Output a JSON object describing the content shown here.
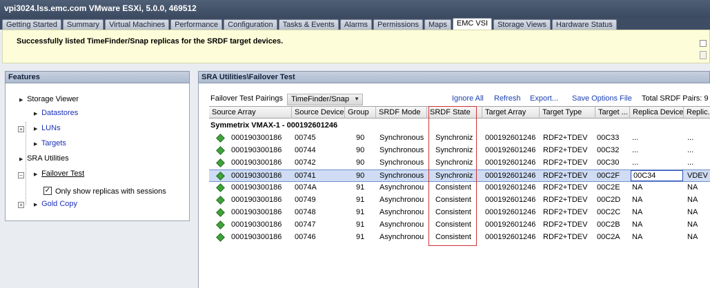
{
  "window": {
    "title": "vpi3024.lss.emc.com VMware ESXi, 5.0.0, 469512"
  },
  "tabs": [
    {
      "label": "Getting Started",
      "active": false
    },
    {
      "label": "Summary",
      "active": false
    },
    {
      "label": "Virtual Machines",
      "active": false
    },
    {
      "label": "Performance",
      "active": false
    },
    {
      "label": "Configuration",
      "active": false
    },
    {
      "label": "Tasks & Events",
      "active": false
    },
    {
      "label": "Alarms",
      "active": false
    },
    {
      "label": "Permissions",
      "active": false
    },
    {
      "label": "Maps",
      "active": false
    },
    {
      "label": "EMC VSI",
      "active": true
    },
    {
      "label": "Storage Views",
      "active": false
    },
    {
      "label": "Hardware Status",
      "active": false
    }
  ],
  "notice": {
    "message": "Successfully listed TimeFinder/Snap replicas for the SRDF target devices."
  },
  "features": {
    "header": "Features",
    "items": {
      "storage_viewer": "Storage Viewer",
      "datastores": "Datastores",
      "luns": "LUNs",
      "targets": "Targets",
      "sra_utilities": "SRA Utilities",
      "failover_test": "Failover Test",
      "only_show_replicas": "Only show replicas with sessions",
      "gold_copy": "Gold Copy"
    },
    "only_show_replicas_checked": true
  },
  "main": {
    "header": "SRA Utilities\\Failover Test",
    "pairings_label": "Failover Test Pairings",
    "pairings_value": "TimeFinder/Snap",
    "links": {
      "ignore_all": "Ignore All",
      "refresh": "Refresh",
      "export": "Export...",
      "save_options": "Save Options File"
    },
    "total_pairs": "Total SRDF Pairs: 9"
  },
  "table": {
    "columns": [
      "Source Array",
      "Source Device",
      "Group",
      "SRDF Mode",
      "SRDF State",
      "Target Array",
      "Target Type",
      "Target ...",
      "Replica Device",
      "Replic..."
    ],
    "group_label": "Symmetrix VMAX-1 - 000192601246",
    "status_color": "#3fa33a",
    "rows": [
      [
        "000190300186",
        "00745",
        "90",
        "Synchronous",
        "Synchroniz",
        "000192601246",
        "RDF2+TDEV",
        "00C33",
        "...",
        "..."
      ],
      [
        "000190300186",
        "00744",
        "90",
        "Synchronous",
        "Synchroniz",
        "000192601246",
        "RDF2+TDEV",
        "00C32",
        "...",
        "..."
      ],
      [
        "000190300186",
        "00742",
        "90",
        "Synchronous",
        "Synchroniz",
        "000192601246",
        "RDF2+TDEV",
        "00C30",
        "...",
        "..."
      ],
      [
        "000190300186",
        "00741",
        "90",
        "Synchronous",
        "Synchroniz",
        "000192601246",
        "RDF2+TDEV",
        "00C2F",
        "00C34",
        "VDEV"
      ],
      [
        "000190300186",
        "0074A",
        "91",
        "Asynchronou",
        "Consistent",
        "000192601246",
        "RDF2+TDEV",
        "00C2E",
        "NA",
        "NA"
      ],
      [
        "000190300186",
        "00749",
        "91",
        "Asynchronou",
        "Consistent",
        "000192601246",
        "RDF2+TDEV",
        "00C2D",
        "NA",
        "NA"
      ],
      [
        "000190300186",
        "00748",
        "91",
        "Asynchronou",
        "Consistent",
        "000192601246",
        "RDF2+TDEV",
        "00C2C",
        "NA",
        "NA"
      ],
      [
        "000190300186",
        "00747",
        "91",
        "Asynchronou",
        "Consistent",
        "000192601246",
        "RDF2+TDEV",
        "00C2B",
        "NA",
        "NA"
      ],
      [
        "000190300186",
        "00746",
        "91",
        "Asynchronou",
        "Consistent",
        "000192601246",
        "RDF2+TDEV",
        "00C2A",
        "NA",
        "NA"
      ]
    ],
    "selected_row": 3
  }
}
